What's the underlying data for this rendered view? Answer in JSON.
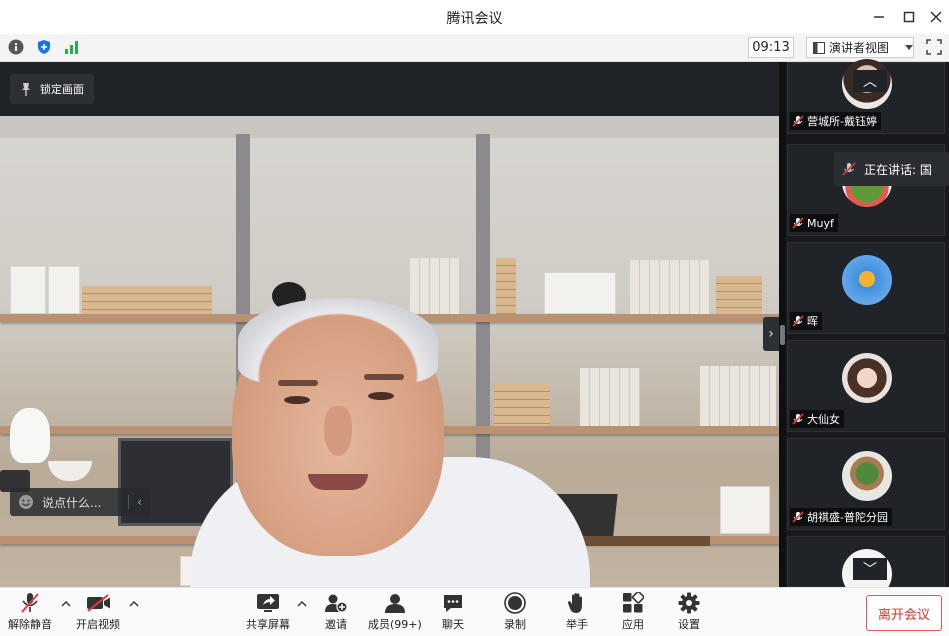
{
  "window": {
    "title": "腾讯会议"
  },
  "infobar": {
    "time": "09:13",
    "view_label": "演讲者视图"
  },
  "main_video": {
    "lock_label": "锁定画面",
    "chat_placeholder": "说点什么..."
  },
  "participants": [
    {
      "name": "营城所-戴钰婷"
    },
    {
      "name": "Muyf"
    },
    {
      "name": "晖"
    },
    {
      "name": "大仙女"
    },
    {
      "name": "胡祺盛-普陀分园"
    }
  ],
  "speaking_banner": "正在讲话: 国",
  "toolbar": {
    "unmute": "解除静音",
    "start_video": "开启视频",
    "share_screen": "共享屏幕",
    "invite": "邀请",
    "members": "成员(99+)",
    "chat": "聊天",
    "record": "录制",
    "raise_hand": "举手",
    "apps": "应用",
    "settings": "设置",
    "leave": "离开会议"
  },
  "colors": {
    "leave_red": "#d9342b",
    "mute_red": "#e0393e",
    "signal_green": "#22b14c",
    "shield_blue": "#1a73e8"
  }
}
